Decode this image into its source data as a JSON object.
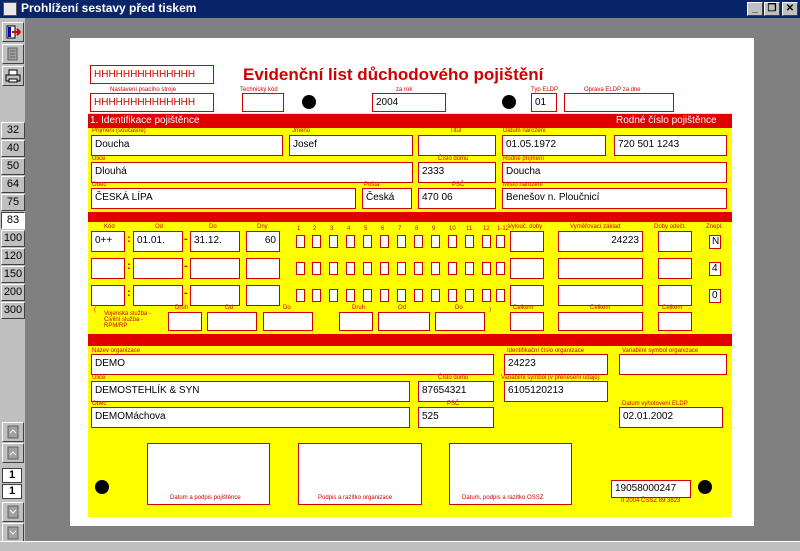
{
  "window": {
    "title": "Prohlížení sestavy před tiskem",
    "min_label": "_",
    "max_label": "❐",
    "close_label": "✕"
  },
  "toolbar": {
    "icons": [
      "exit-icon",
      "page-setup-icon",
      "print-icon"
    ],
    "zoom_levels": [
      "32",
      "40",
      "50",
      "64",
      "75",
      "83",
      "100",
      "120",
      "150",
      "200",
      "300"
    ],
    "active_zoom": "83",
    "page_current": "1",
    "page_total": "1"
  },
  "header": {
    "doc_title": "Evidenční list důchodového pojištění",
    "code_top": "HHHHHHHHHHHHHH",
    "code_bottom": "HHHHHHHHHHHHHH",
    "lbl_nastaveni": "Nastavení psacího stroje",
    "lbl_technicky": "Technický kód",
    "lbl_za_rok": "za rok",
    "za_rok": "2004",
    "lbl_typ": "Typ ELDP",
    "typ": "01",
    "lbl_oprava": "Oprava ELDP za dne"
  },
  "section1": {
    "title": "1. Identifikace pojištěnce",
    "rodne_title": "Rodné číslo pojištěnce",
    "lbl_prijmeni": "Příjmení (současné)",
    "prijmeni": "Doucha",
    "lbl_jmeno": "Jméno",
    "jmeno": "Josef",
    "lbl_titul": "Titul",
    "titul": "",
    "lbl_datum_nar": "Datum narození",
    "datum_nar": "01.05.1972",
    "rodne_cislo": "720 501 1243",
    "lbl_ulice": "Ulice",
    "ulice": "Dlouhá",
    "lbl_cislo_domu": "Číslo domu",
    "cislo_domu": "2333",
    "lbl_rodne_prijmeni": "Rodné příjmení",
    "rodne_prijmeni": "Doucha",
    "lbl_obec": "Obec",
    "obec": "ČESKÁ LÍPA",
    "lbl_posta": "Pošta",
    "posta": "Česká",
    "lbl_psc": "PSČ",
    "psc": "470 06",
    "lbl_misto_nar": "Místo narození",
    "misto_nar": "Benešov n. Ploučnicí"
  },
  "periods": {
    "lbl_kod": "Kód",
    "lbl_od": "Od",
    "lbl_do": "Do",
    "lbl_dny": "Dny",
    "months": [
      "1",
      "2",
      "3",
      "4",
      "5",
      "6",
      "7",
      "8",
      "9",
      "10",
      "11",
      "12",
      "1-12"
    ],
    "lbl_vylouc": "Vylouč. doby",
    "lbl_vymerovaci": "Vyměřovací základ",
    "lbl_doby_odecet": "Doby odečt.",
    "lbl_znepl": "Znepl.",
    "rows": [
      {
        "kod": "0++",
        "od": "01.01.",
        "do": "31.12.",
        "dny": "60",
        "vymerovaci": "24223",
        "znepl": "N"
      },
      {
        "kod": "",
        "od": "",
        "do": "",
        "dny": "",
        "vymerovaci": "",
        "znepl": "4"
      },
      {
        "kod": "",
        "od": "",
        "do": "",
        "dny": "",
        "vymerovaci": "",
        "znepl": "0"
      }
    ],
    "lbl_vojenska": "Vojenská služba - Civilní služba - RPM/RP",
    "lbl_druh": "Druh",
    "lbl_celkem": "Celkem"
  },
  "section2": {
    "lbl_nazev_org": "Název organizace",
    "nazev_org": "DEMO",
    "lbl_ico": "Identifikační číslo organizace",
    "ico": "24223",
    "lbl_var_symbol": "Variabilní symbol organizace",
    "var_symbol": "",
    "lbl_ulice": "Ulice",
    "ulice": "DEMOSTEHLÍK & SYN",
    "lbl_cislo_domu": "Číslo domu",
    "cislo_domu": "87654321",
    "lbl_var_symbol_plat": "Variabilní symbol (v přenesení údajů)",
    "var_symbol_plat": "6105120213",
    "lbl_obec": "Obec",
    "obec": "DEMOMáchova",
    "lbl_psc": "PSČ",
    "psc": "525",
    "lbl_datum_vyhot": "Datum vyhotovení ELDP",
    "datum_vyhot": "02.01.2002"
  },
  "footer": {
    "lbl_podpis_poj": "Datum a podpis pojištěnce",
    "lbl_podpis_org": "Podpis a razítko organizace",
    "lbl_podpis_ossz": "Datum, podpis a razítko OSSZ",
    "serial": "19058000247",
    "small_code": "II 2004 ČSSZ 89 3823"
  }
}
